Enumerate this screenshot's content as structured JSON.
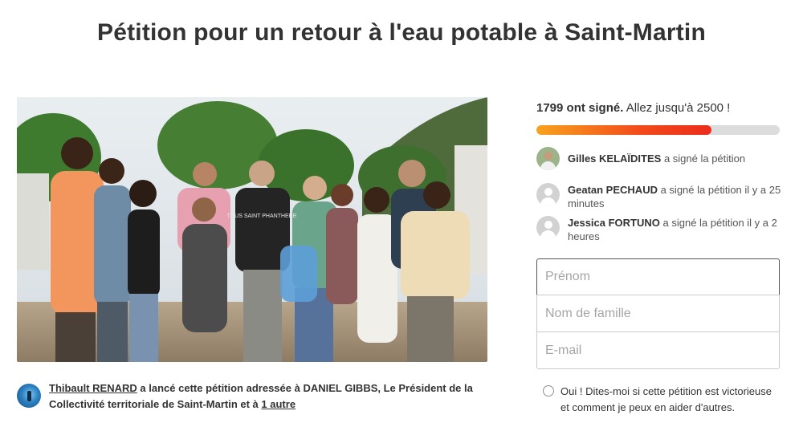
{
  "page": {
    "title": "Pétition pour un retour à l'eau potable à Saint-Martin"
  },
  "photo": {
    "shirt_print": "TOUS SAINT PHANTHERE"
  },
  "starter": {
    "name": "Thibault RENARD",
    "text": "a lancé cette pétition adressée à DANIEL GIBBS, Le Président de la Collectivité territoriale de Saint-Martin et à",
    "others_link": "1 autre"
  },
  "signatures": {
    "count_text": "1799 ont signé.",
    "goal_text": "Allez jusqu'à 2500 !",
    "count": 1799,
    "goal": 2500,
    "progress_fraction": 0.72
  },
  "recent_signers": [
    {
      "name": "Gilles KELAÏDITES",
      "action": "a signé la pétition",
      "avatar": "photo"
    },
    {
      "name": "Geatan PECHAUD",
      "action": "a signé la pétition il y a 25 minutes",
      "avatar": "default"
    },
    {
      "name": "Jessica FORTUNO",
      "action": "a signé la pétition il y a 2 heures",
      "avatar": "default"
    }
  ],
  "form": {
    "first_name_placeholder": "Prénom",
    "last_name_placeholder": "Nom de famille",
    "email_placeholder": "E-mail",
    "optin_label": "Oui ! Dites-moi si cette pétition est victorieuse et comment je peux en aider d'autres."
  },
  "colors": {
    "progress_start": "#f8a21e",
    "progress_end": "#ec2c1c",
    "progress_track": "#dcdcdc",
    "text": "#333333"
  }
}
